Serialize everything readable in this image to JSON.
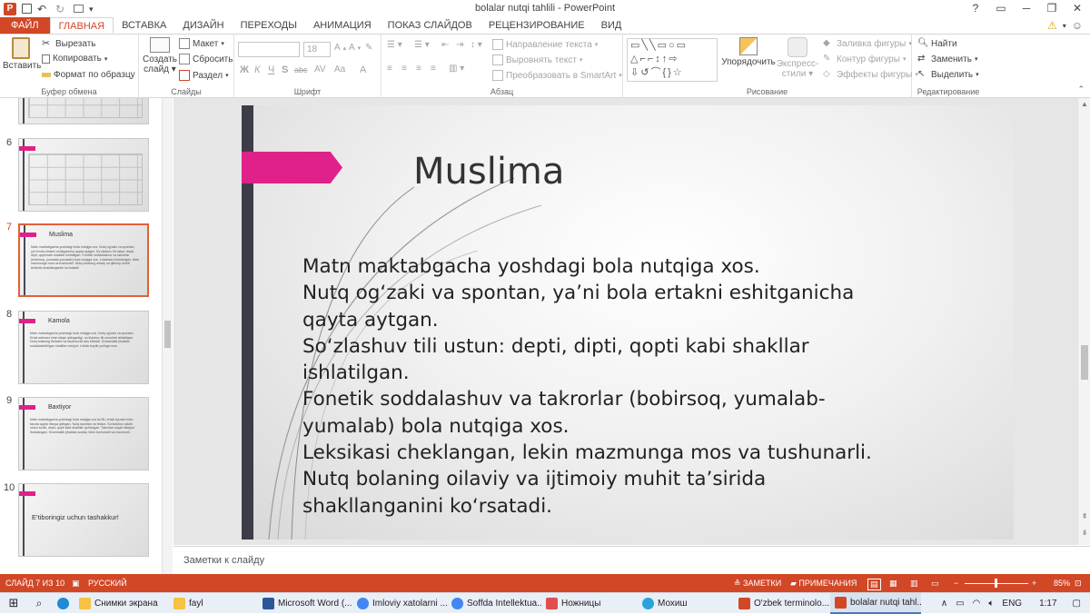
{
  "window": {
    "title": "bolalar nutqi tahlili - PowerPoint",
    "help": "?",
    "controls": [
      "▭",
      "─",
      "❐",
      "✕"
    ]
  },
  "tabs": {
    "file": "ФАЙЛ",
    "items": [
      "ГЛАВНАЯ",
      "ВСТАВКА",
      "ДИЗАЙН",
      "ПЕРЕХОДЫ",
      "АНИМАЦИЯ",
      "ПОКАЗ СЛАЙДОВ",
      "РЕЦЕНЗИРОВАНИЕ",
      "ВИД"
    ],
    "active_index": 0
  },
  "ribbon": {
    "clipboard": {
      "paste": "Вставить",
      "cut": "Вырезать",
      "copy": "Копировать",
      "format_painter": "Формат по образцу",
      "label": "Буфер обмена"
    },
    "slides": {
      "new_slide_1": "Создать",
      "new_slide_2": "слайд",
      "layout": "Макет",
      "reset": "Сбросить",
      "section": "Раздел",
      "label": "Слайды"
    },
    "font": {
      "size": "18",
      "bold": "Ж",
      "italic": "К",
      "underline": "Ч",
      "shadow": "S",
      "strike": "abc",
      "spacing": "AV",
      "case": "Aa",
      "color": "A",
      "label": "Шрифт"
    },
    "paragraph": {
      "direction": "Направление текста",
      "align": "Выровнять текст",
      "smartart": "Преобразовать в SmartArt",
      "label": "Абзац"
    },
    "drawing": {
      "arrange": "Упорядочить",
      "styles_1": "Экспресс-",
      "styles_2": "стили",
      "fill": "Заливка фигуры",
      "outline": "Контур фигуры",
      "effects": "Эффекты фигуры",
      "label": "Рисование"
    },
    "editing": {
      "find": "Найти",
      "replace": "Заменить",
      "select": "Выделить",
      "label": "Редактирование"
    }
  },
  "thumbnails": [
    {
      "number": "",
      "title": "",
      "kind": "table"
    },
    {
      "number": "6",
      "title": "",
      "kind": "table"
    },
    {
      "number": "7",
      "title": "Muslima",
      "kind": "text",
      "selected": true,
      "text": "Matn maktabgacha yoshdagi bola nutqiga xos. Nutq og‘zaki va spontan, ya’ni bola ertakni eshitganicha qayta aytgan. So‘zlashuv tili ustun: depti, dipti, qopti kabi shakllar ishlatilgan. Fonetik soddalashuv va takrorlar (bobirsoq, yumalab-yumalab) bola nutqiga xos. Leksikasi cheklangan, lekin mazmunga mos va tushunarli. Nutq bolaning oilaviy va ijtimoiy muhit ta’sirida shakllanganini ko‘rsatadi."
    },
    {
      "number": "8",
      "title": "Kamola",
      "kind": "text",
      "text": "Matn maktabgacha yoshdagi bola nutqiga xos. Nutq og‘zaki va spontan. Ertak sahnasi erkin talqin qilinganligi, so‘zlashuv tili unsurlari ishlatilgan. Nutq bolaning fikrlashi va tasavvurini aks ettiradi. Grammatik jihatdan soddalashtirilgan shakllar mavjud. Leksik boylik yoshga mos."
    },
    {
      "number": "9",
      "title": "Baxtiyor",
      "kind": "text",
      "text": "Matn maktabgacha yoshdagi bola nutqiga xos bo‘lib, ertak og‘zaki erkin tarzda qayta hikoya qilingan. Nutq spontan va tezkor. So‘zlashuv uslubi ustun bo‘lib, depti, qopti kabi shakllar qo‘llangan. Takrorlar orqali hissiyot ifodalangan. Grammatik jihatdan sodda, lekin tushunarli va mazmunli."
    },
    {
      "number": "10",
      "title": "E’tiboringiz uchun tashakkur!",
      "kind": "end"
    }
  ],
  "slide": {
    "title": "Muslima",
    "lines": [
      "Matn maktabgacha yoshdagi bola nutqiga xos.",
      "Nutq og‘zaki va spontan, ya’ni bola ertakni eshitganicha",
      "qayta aytgan.",
      "So‘zlashuv tili ustun: depti, dipti, qopti kabi shakllar",
      "ishlatilgan.",
      "Fonetik soddalashuv va takrorlar (bobirsoq, yumalab-",
      "yumalab) bola nutqiga xos.",
      "Leksikasi cheklangan, lekin mazmunga mos va tushunarli.",
      "Nutq bolaning oilaviy va ijtimoiy muhit ta’sirida",
      "shakllanganini ko‘rsatadi."
    ],
    "accent_color": "#e0218a",
    "bar_color": "#3d3d48"
  },
  "notes": {
    "placeholder": "Заметки к слайду"
  },
  "status": {
    "slide_info": "СЛАЙД 7 ИЗ 10",
    "language": "РУССКИЙ",
    "notes_btn": "ЗАМЕТКИ",
    "comments_btn": "ПРИМЕЧАНИЯ",
    "zoom": "85%",
    "color": "#d24726"
  },
  "taskbar": {
    "items": [
      {
        "label": "Снимки экрана",
        "color": "#f5c242"
      },
      {
        "label": "fayl",
        "color": "#f5c242"
      },
      {
        "label": "Microsoft Word (...",
        "color": "#2b579a"
      },
      {
        "label": "Imloviy xatolarni ...",
        "color": "#4285f4"
      },
      {
        "label": "Soffda Intellektua...",
        "color": "#4285f4"
      },
      {
        "label": "Ножницы",
        "color": "#e04e4e"
      },
      {
        "label": "Мохиш",
        "color": "#2aa3dc"
      },
      {
        "label": "O'zbek terminolo...",
        "color": "#d24726"
      },
      {
        "label": "bolalar nutqi tahl...",
        "color": "#d24726",
        "active": true
      }
    ],
    "lang": "ENG",
    "time": "1:17"
  }
}
